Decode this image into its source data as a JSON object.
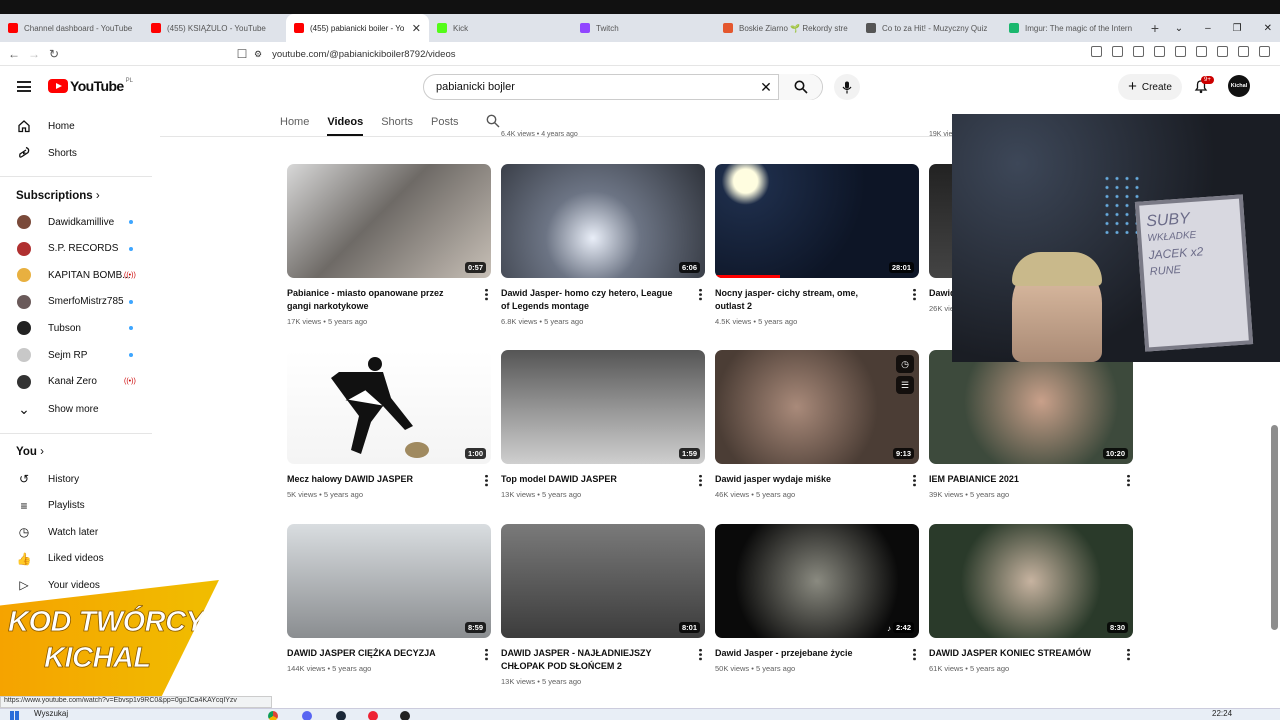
{
  "browser": {
    "tabs": [
      {
        "title": "Channel dashboard - YouTube",
        "color": "#ff0000",
        "active": false
      },
      {
        "title": "(455) KSIĄŻULO - YouTube",
        "color": "#ff0000",
        "active": false
      },
      {
        "title": "(455) pabianicki boiler - Yo",
        "color": "#ff0000",
        "active": true
      },
      {
        "title": "Kick",
        "color": "#53fc18",
        "active": false
      },
      {
        "title": "Twitch",
        "color": "#9146ff",
        "active": false
      },
      {
        "title": "Boskie Ziarno 🌱 Rekordy stre",
        "color": "#e4572e",
        "active": false
      },
      {
        "title": "Co to za Hit! - Muzyczny Quiz",
        "color": "#555555",
        "active": false
      },
      {
        "title": "Imgur: The magic of the Intern",
        "color": "#1bb76e",
        "active": false
      }
    ],
    "url": "youtube.com/@pabianickiboiler8792/videos",
    "status_url": "https://www.youtube.com/watch?v=Ebvsp1v9RC0&pp=0gcJCa4KAYcqIYzv"
  },
  "header": {
    "logo_text": "YouTube",
    "logo_region": "PL",
    "search_query": "pabianicki bojler",
    "create_label": "Create",
    "notifications_badge": "9+",
    "avatar_text": "Kichal"
  },
  "sidebar": {
    "main": [
      {
        "label": "Home",
        "icon": "home-icon"
      },
      {
        "label": "Shorts",
        "icon": "shorts-icon"
      }
    ],
    "subscriptions_title": "Subscriptions",
    "subscriptions": [
      {
        "label": "Dawidkamillive",
        "status": "dot",
        "color": "#7a4a3a"
      },
      {
        "label": "S.P. RECORDS",
        "status": "dot",
        "color": "#b03030"
      },
      {
        "label": "KAPITAN BOMB...",
        "status": "live",
        "color": "#e8b040"
      },
      {
        "label": "SmerfoMistrz785",
        "status": "dot",
        "color": "#6a5a5a"
      },
      {
        "label": "Tubson",
        "status": "dot",
        "color": "#222222"
      },
      {
        "label": "Sejm RP",
        "status": "dot",
        "color": "#c8c8c8"
      },
      {
        "label": "Kanał Zero",
        "status": "live",
        "color": "#333333"
      }
    ],
    "show_more": "Show more",
    "you_title": "You",
    "you": [
      {
        "label": "History",
        "icon": "history-icon"
      },
      {
        "label": "Playlists",
        "icon": "playlists-icon"
      },
      {
        "label": "Watch later",
        "icon": "watch-later-icon"
      },
      {
        "label": "Liked videos",
        "icon": "liked-icon"
      },
      {
        "label": "Your videos",
        "icon": "your-videos-icon"
      }
    ]
  },
  "channel_tabs": [
    "Home",
    "Videos",
    "Shorts",
    "Posts"
  ],
  "previous_row_meta": [
    "6.4K views • 4 years ago",
    "19K views"
  ],
  "videos": [
    {
      "title": "Pabianice - miasto opanowane przez gangi narkotykowe",
      "views": "17K views",
      "age": "5 years ago",
      "duration": "0:57",
      "progress": 0,
      "bg": "linear-gradient(135deg,#d8d8d8,#6e6a66 45%,#c7bfb6)"
    },
    {
      "title": "Dawid Jasper- homo czy hetero, League of Legends montage",
      "views": "6.8K views",
      "age": "5 years ago",
      "duration": "6:06",
      "progress": 0,
      "bg": "radial-gradient(circle at 45% 65%,#e9eef8,#6c7484 35%,#2f333b)"
    },
    {
      "title": "Nocny jasper- cichy stream, ome, outlast 2",
      "views": "4.5K views",
      "age": "5 years ago",
      "duration": "28:01",
      "progress": 0.32,
      "bg": "radial-gradient(circle at 15% 15%,#fffde0 6%,#1d2c48 12%,#0d1526 60%),linear-gradient(#1a2640,#0a0f1c)"
    },
    {
      "title": "Dawid...",
      "views": "26K views",
      "age": "",
      "duration": "",
      "progress": 0,
      "bg": "linear-gradient(#222,#444)"
    },
    {
      "title": "Mecz halowy DAWID JASPER",
      "views": "5K views",
      "age": "5 years ago",
      "duration": "1:00",
      "progress": 0,
      "bg": "linear-gradient(#ffffff,#f4f4f4)"
    },
    {
      "title": "Top model DAWID JASPER",
      "views": "13K views",
      "age": "5 years ago",
      "duration": "1:59",
      "progress": 0,
      "bg": "linear-gradient(#555,#9a9a9a 55%,#cfcfcf)"
    },
    {
      "title": "Dawid jasper wydaje miśke",
      "views": "46K views",
      "age": "5 years ago",
      "duration": "9:13",
      "progress": 0,
      "bg": "radial-gradient(circle at 40% 50%,#a98a7a,#4b3d35 60%)"
    },
    {
      "title": "IEM PABIANICE 2021",
      "views": "39K views",
      "age": "5 years ago",
      "duration": "10:20",
      "progress": 0,
      "bg": "radial-gradient(circle at 55% 45%,#c9a08a,#3d4a3c 60%)"
    },
    {
      "title": "DAWID JASPER CIĘŻKA DECYZJA",
      "views": "144K views",
      "age": "5 years ago",
      "duration": "8:59",
      "progress": 0,
      "bg": "linear-gradient(#d9dde0,#8a8d90)"
    },
    {
      "title": "DAWID JASPER - NAJŁADNIEJSZY CHŁOPAK POD SŁOŃCEM 2",
      "views": "13K views",
      "age": "5 years ago",
      "duration": "8:01",
      "progress": 0,
      "bg": "linear-gradient(#7a7a7a,#3c3c3c)"
    },
    {
      "title": "Dawid Jasper - przejebane życie",
      "views": "50K views",
      "age": "5 years ago",
      "duration": "2:42",
      "progress": 0,
      "bg": "radial-gradient(circle at 50% 50%,#8a8a80,#0a0a0a 70%)"
    },
    {
      "title": "DAWID JASPER KONIEC STREAMÓW",
      "views": "61K views",
      "age": "5 years ago",
      "duration": "8:30",
      "progress": 0,
      "bg": "radial-gradient(circle at 50% 50%,#c7b3a0,#2a3a2a 60%)"
    }
  ],
  "webcam_board": [
    "SUBY",
    "WKŁADKE",
    "JACEK x2",
    "RUNE"
  ],
  "banner": {
    "line1": "KOD TWÓRCY",
    "line2": "KICHAL"
  },
  "taskbar": {
    "search": "Wyszukaj",
    "time": "22:24"
  }
}
